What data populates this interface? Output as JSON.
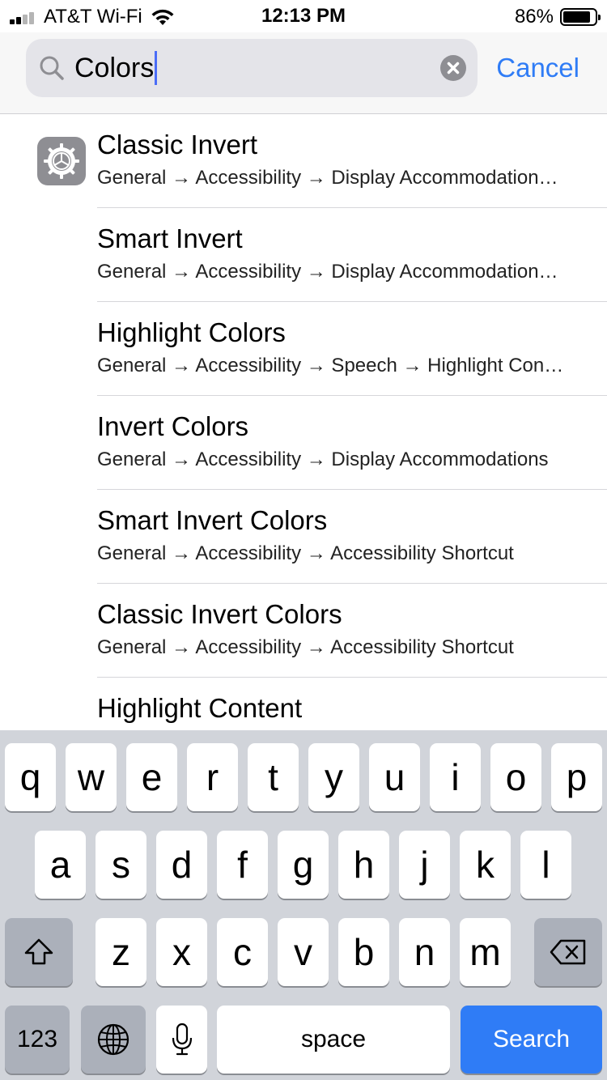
{
  "status_bar": {
    "carrier": "AT&T Wi-Fi",
    "time": "12:13 PM",
    "battery_percent": "86%",
    "battery_level": 0.86,
    "signal_bars_active": 2
  },
  "search": {
    "query": "Colors",
    "cancel_label": "Cancel"
  },
  "results": [
    {
      "title": "Classic Invert",
      "path": "General → Accessibility → Display Accommodation…",
      "icon": "gear-icon"
    },
    {
      "title": "Smart Invert",
      "path": "General → Accessibility → Display Accommodation…"
    },
    {
      "title": "Highlight Colors",
      "path": "General → Accessibility → Speech → Highlight Con…"
    },
    {
      "title": "Invert Colors",
      "path": "General → Accessibility → Display Accommodations"
    },
    {
      "title": "Smart Invert Colors",
      "path": "General → Accessibility → Accessibility Shortcut"
    },
    {
      "title": "Classic Invert Colors",
      "path": "General → Accessibility → Accessibility Shortcut"
    },
    {
      "title": "Highlight Content",
      "path": ""
    }
  ],
  "keyboard": {
    "row1": [
      "q",
      "w",
      "e",
      "r",
      "t",
      "y",
      "u",
      "i",
      "o",
      "p"
    ],
    "row2": [
      "a",
      "s",
      "d",
      "f",
      "g",
      "h",
      "j",
      "k",
      "l"
    ],
    "row3": [
      "z",
      "x",
      "c",
      "v",
      "b",
      "n",
      "m"
    ],
    "numbers_label": "123",
    "space_label": "space",
    "search_label": "Search"
  },
  "colors": {
    "accent": "#2f7cf6",
    "keyboard_bg": "#d1d4da",
    "icon_gray": "#8e8e93"
  }
}
